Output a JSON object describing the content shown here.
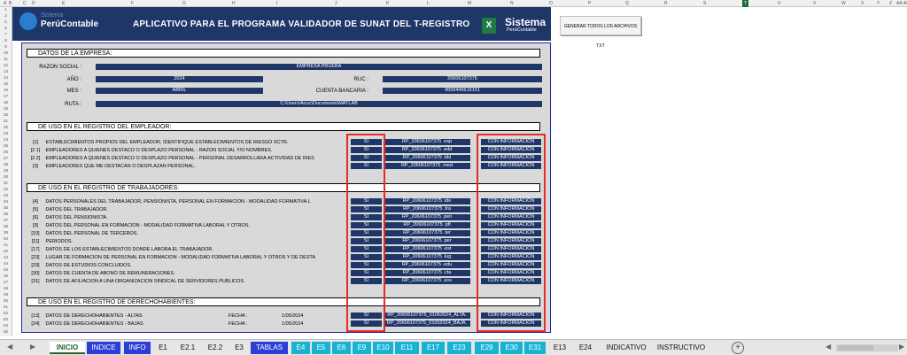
{
  "columns": [
    "A",
    "B",
    "C",
    "D",
    "E",
    "F",
    "G",
    "H",
    "I",
    "J",
    "K",
    "L",
    "M",
    "N",
    "O",
    "P",
    "Q",
    "R",
    "S",
    "T",
    "U",
    "V",
    "W",
    "X",
    "Y",
    "Z",
    "AA",
    "AB"
  ],
  "active_column": "T",
  "rows": [
    "1",
    "2",
    "5",
    "6",
    "7",
    "8",
    "9",
    "10",
    "11",
    "12",
    "13",
    "14",
    "15",
    "16",
    "17",
    "18",
    "19",
    "20",
    "21",
    "22",
    "23",
    "24",
    "25",
    "26",
    "27",
    "28",
    "29",
    "30",
    "31",
    "32",
    "33",
    "34",
    "35",
    "36",
    "37",
    "38",
    "39",
    "40",
    "41",
    "42",
    "43",
    "44",
    "45",
    "46",
    "47",
    "48",
    "49",
    "50",
    "51",
    "52",
    "53",
    "54",
    "55"
  ],
  "banner": {
    "logo_top": "Sistema",
    "logo_name": "PerúContable",
    "title": "APLICATIVO PARA EL PROGRAMA VALIDADOR DE SUNAT DEL T-REGISTRO",
    "xl_icon": "X",
    "brand": "Sistema",
    "brand_sub": "PerúContable"
  },
  "generate_button": "GENERAR TODOS LOS ARCHIVOS TXT",
  "empresa": {
    "header": "DATOS DE LA EMPRESA:",
    "razon_label": "RAZON SOCIAL :",
    "razon_value": "EMPRESA PRUEBA",
    "anio_label": "AÑO :",
    "anio_value": "2024",
    "ruc_label": "RUC :",
    "ruc_value": "20606107375",
    "mes_label": "MES :",
    "mes_value": "ABRIL",
    "cuenta_label": "CUENTA BANCARIA :",
    "cuenta_value": "965944651615​1",
    "ruta_label": "RUTA :",
    "ruta_value": "C:\\Users\\Acuc\\Documents\\MATLAB"
  },
  "empleador": {
    "header": "DE USO EN EL REGISTRO DEL EMPLEADOR:",
    "rows": [
      {
        "code": "[1]",
        "text": "ESTABLECIMIENTOS PROPIOS DEL EMPLEADOR, IDENTIFIQUE ESTABLECIMIENTOS DE RIESGO SCTR.",
        "si": "SI",
        "file": "RP_20606107375 .esp",
        "info": "CON INFORMACIÓN"
      },
      {
        "code": "[2.1]",
        "text": "EMPLEADORES A QUIENES DESTACO O DESPLAZO PERSONAL - RAZON SOCIAL Y/O NOMBRES.",
        "si": "SI",
        "file": "RP_20606107375 .edd",
        "info": "CON INFORMACIÓN"
      },
      {
        "code": "[2.2]",
        "text": "EMPLEADORES A QUIENES DESTACO O DESPLAZO PERSONAL - PERSONAL DESARROLLARÁ ACTIVIDAD DE RIES",
        "si": "SI",
        "file": "RP_20606107375 .ldd",
        "info": "CON INFORMACIÓN"
      },
      {
        "code": "[3]",
        "text": "EMPLEADORES QUE ME DESTACAN O DESPLAZAN PERSONAL.",
        "si": "SI",
        "file": "RP_20606107375 .med",
        "info": "CON INFORMACIÓN"
      }
    ]
  },
  "trabajadores": {
    "header": "DE USO EN EL REGISTRO DE TRABAJADORES:",
    "rows": [
      {
        "code": "[4]",
        "text": "DATOS PERSONALES DEL TRABAJADOR, PENSIONISTA, PERSONAL EN FORMACIÓN - MODALIDAD FORMATIVA L",
        "si": "SI",
        "file": "RP_20606107375 .ide",
        "info": "CON INFORMACIÓN"
      },
      {
        "code": "[5]",
        "text": "DATOS DEL TRABAJADOR.",
        "si": "SI",
        "file": "RP_20606107375 .tra",
        "info": "CON INFORMACIÓN"
      },
      {
        "code": "[6]",
        "text": "DATOS DEL PENSIONISTA.",
        "si": "SI",
        "file": "RP_20606107375 .pen",
        "info": "CON INFORMACIÓN"
      },
      {
        "code": "[9]",
        "text": "DATOS DEL PERSONAL EN FORMACIÓN - MODALIDAD FORMATIVA LABORAL Y OTROS.",
        "si": "SI",
        "file": "RP_20606107375 .pfl",
        "info": "CON INFORMACIÓN"
      },
      {
        "code": "[10]",
        "text": "DATOS DEL PERSONAL DE TERCEROS.",
        "si": "SI",
        "file": "RP_20606107375 .ter",
        "info": "CON INFORMACIÓN"
      },
      {
        "code": "[11]",
        "text": "PERÍODOS.",
        "si": "SI",
        "file": "RP_20606107375 .per",
        "info": "CON INFORMACIÓN"
      },
      {
        "code": "[17]",
        "text": "DATOS DE LOS ESTABLECIMIENTOS DONDE LABORA EL TRABAJADOR.",
        "si": "SI",
        "file": "RP_20606107375 .est",
        "info": "CON INFORMACIÓN"
      },
      {
        "code": "[23]",
        "text": "LUGAR DE FORMACIÓN DE PERSONAL EN FORMACIÓN - MODALIDAD FORMATIVA LABORAL Y OTROS Y DE DESTA",
        "si": "SI",
        "file": "RP_20606107375 .lug",
        "info": "CON INFORMACIÓN"
      },
      {
        "code": "[29]",
        "text": "DATOS DE ESTUDIOS CONCLUIDOS.",
        "si": "SI",
        "file": "RP_20606107375 .edu",
        "info": "CON INFORMACIÓN"
      },
      {
        "code": "[30]",
        "text": "DATOS DE CUENTA DE ABONO DE REMUNERACIONES.",
        "si": "SI",
        "file": "RP_20606107375 .cta",
        "info": "CON INFORMACIÓN"
      },
      {
        "code": "[31]",
        "text": "DATOS DE AFILIACIÓN A UNA ORGANIZACIÓN SINDICAL DE SERVIDORES PÚBLICOS.",
        "si": "SI",
        "file": "RP_20606107375 .sos",
        "info": "CON INFORMACIÓN"
      }
    ]
  },
  "derechohabientes": {
    "header": "DE USO EN EL REGISTRO DE DERECHOHABIENTES:",
    "rows": [
      {
        "code": "[13]",
        "text": "DATOS DE DERECHOHABIENTES - ALTAS",
        "fecha_label": "FECHA :",
        "fecha": "1/05/2024",
        "si": "SI",
        "file": "RP_20606107375_01052024_ALTA.",
        "info": "CON INFORMACIÓN"
      },
      {
        "code": "[24]",
        "text": "DATOS DE DERECHOHABIENTES - BAJAS",
        "fecha_label": "FECHA :",
        "fecha": "1/05/2024",
        "si": "SI",
        "file": "RP_20606107375_01052024_BAJA.",
        "info": "CON INFORMACIÓN"
      }
    ]
  },
  "tabs": [
    "INICIO",
    "INDICE",
    "INFO",
    "E1",
    "E2.1",
    "E2.2",
    "E3",
    "TABLAS",
    "E4",
    "E5",
    "E6",
    "E9",
    "E10",
    "E11",
    "E17",
    "E23",
    "E29",
    "E30",
    "E31",
    "E13",
    "E24",
    "INDICATIVO",
    "INSTRUCTIVO"
  ],
  "colors": {
    "navy": "#1f3668",
    "red": "#e52a2a",
    "tab_blue": "#2b3fd6",
    "tab_cyan": "#17b3d3",
    "excel_green": "#1d6b3e"
  }
}
